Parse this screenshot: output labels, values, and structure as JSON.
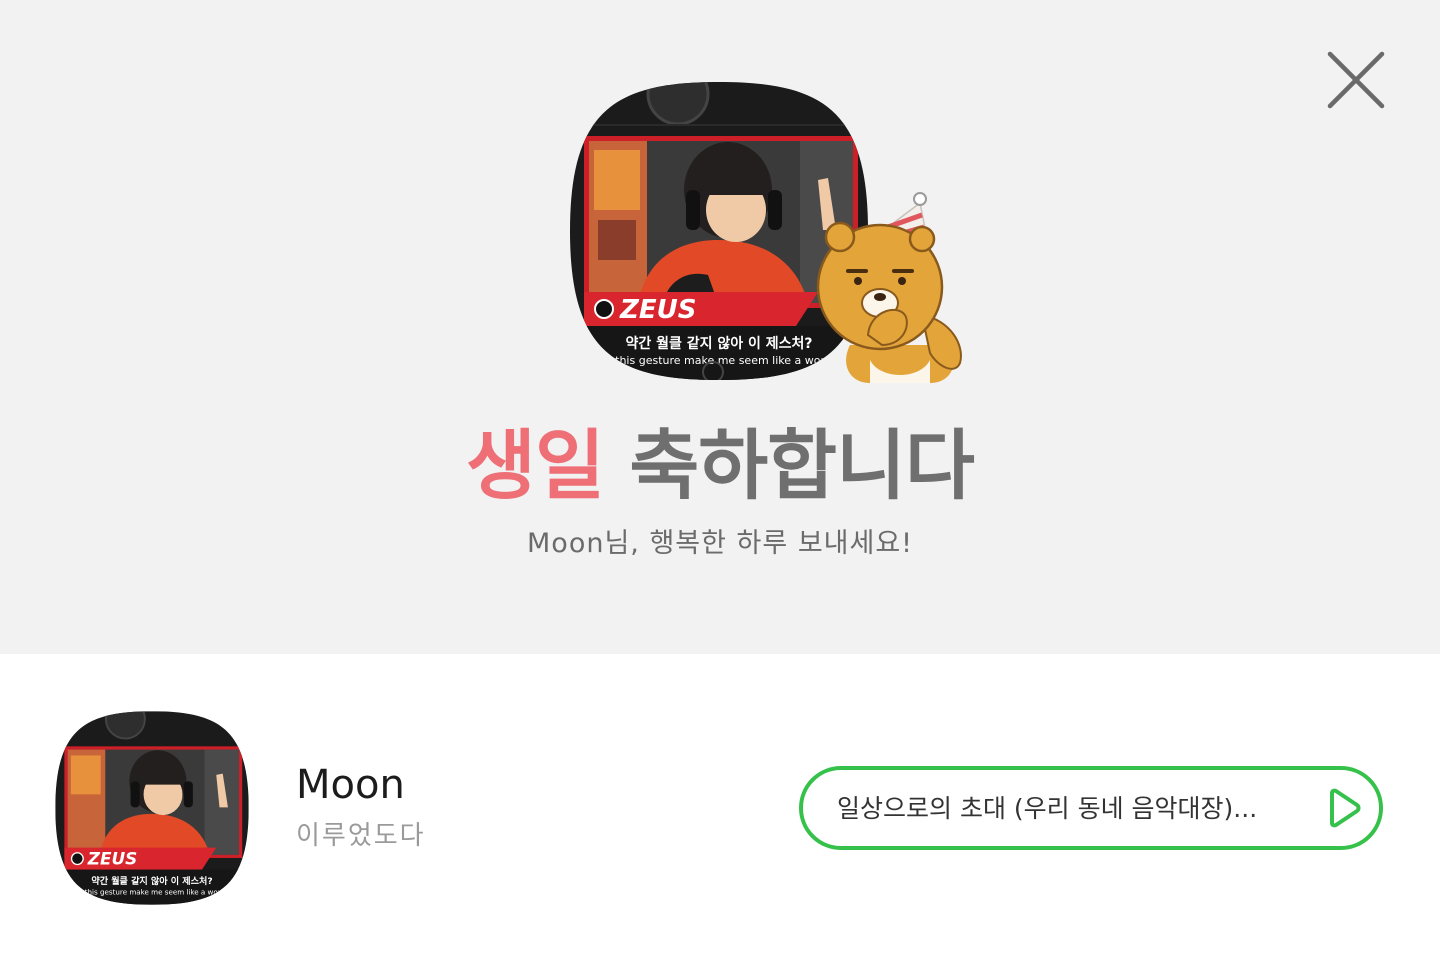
{
  "banner": {
    "headline_accent": "생일",
    "headline_rest": "축하합니다",
    "subline": "Moon님, 행복한 하루 보내세요!",
    "close_icon": "close-icon",
    "colors": {
      "background": "#f2f2f2",
      "accent": "#ee6f76",
      "headline_gray": "#6f6f6f"
    }
  },
  "profile": {
    "name": "Moon",
    "status_message": "이루었도다",
    "avatar_image": {
      "caption_brand": "ZEUS",
      "caption_ko": "약간 월클 같지 않아 이 제스처?",
      "caption_en": "Isn't this gesture make me seem like a world-fa"
    }
  },
  "music": {
    "label": "일상으로의 초대 (우리 동네 음악대장)...",
    "play_icon": "play-icon",
    "accent_color": "#35c14a"
  }
}
